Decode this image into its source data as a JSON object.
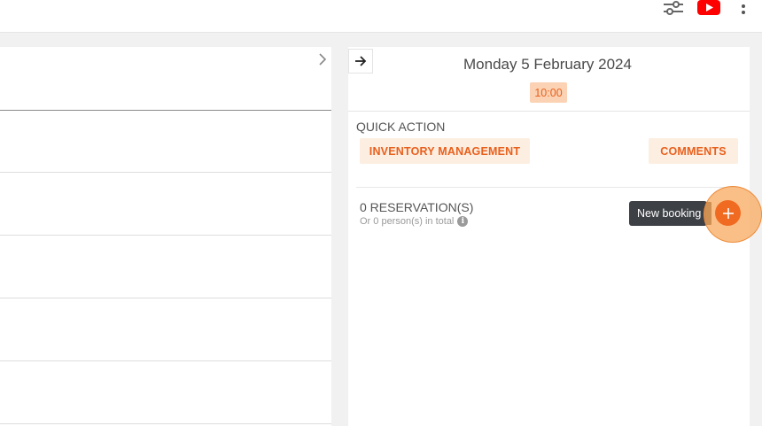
{
  "topbar": {
    "icons": [
      "sliders-icon",
      "youtube-icon",
      "more-vert-icon"
    ]
  },
  "left_panel": {
    "nav_icon": "chevron-right-icon"
  },
  "right_panel": {
    "collapse_icon": "arrow-right-icon",
    "date_title": "Monday 5 February 2024",
    "time_chip": "10:00",
    "quick_action": {
      "label": "QUICK ACTION",
      "buttons": [
        "INVENTORY MANAGEMENT",
        "COMMENTS"
      ]
    },
    "reservations": {
      "count_text": "0 RESERVATION(S)",
      "total_text": "Or 0 person(s) in total",
      "info_icon_glyph": "i"
    },
    "new_booking": {
      "tooltip": "New booking",
      "icon": "plus-icon"
    }
  },
  "colors": {
    "accent": "#f06a21",
    "accent_light": "#fdeee2",
    "chip_bg": "#fbd2b4",
    "tooltip_bg": "#3d4045",
    "youtube_red": "#ff0000"
  }
}
